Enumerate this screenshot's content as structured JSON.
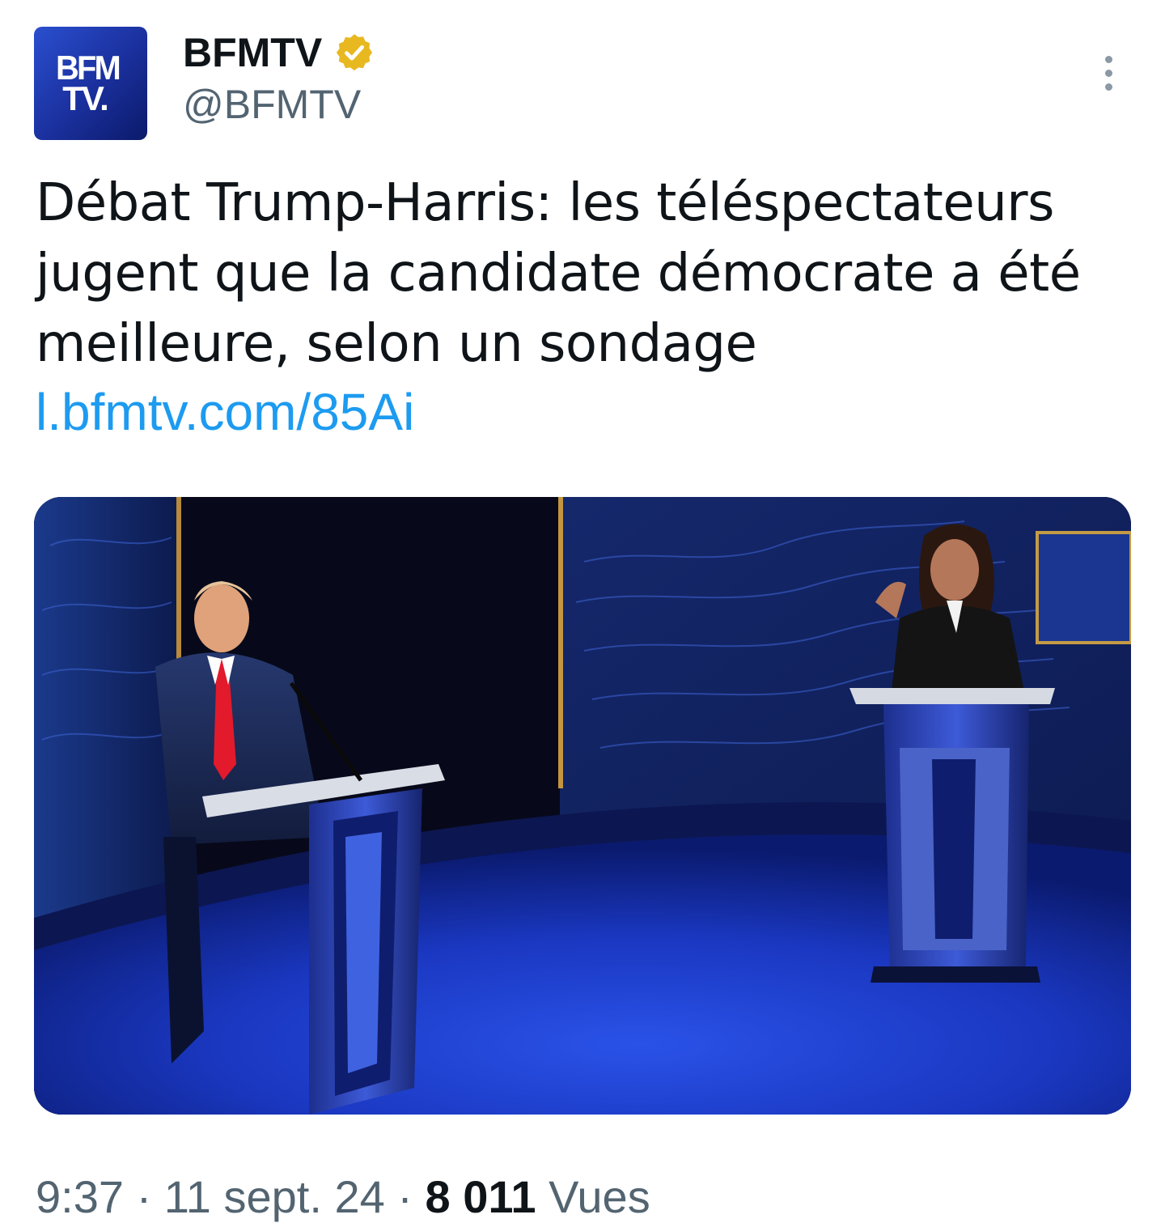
{
  "account": {
    "avatar_line1": "BFM",
    "avatar_line2": "TV.",
    "display_name": "BFMTV",
    "handle": "@BFMTV",
    "verified_icon": "gold-verified-badge-icon",
    "verified_color": "#e8b820"
  },
  "tweet": {
    "text_line1": "Débat Trump-Harris: les téléspectateurs",
    "text_line2": "jugent que la candidate démocrate a été",
    "text_line3": "meilleure, selon un sondage",
    "link": "l.bfmtv.com/85Ai",
    "link_color": "#1d9bf0"
  },
  "footer": {
    "time": "9:37",
    "separator": "·",
    "date": "11 sept. 24",
    "views_count": "8 011",
    "views_label": "Vues"
  },
  "icons": {
    "more": "more-vertical-icon"
  }
}
